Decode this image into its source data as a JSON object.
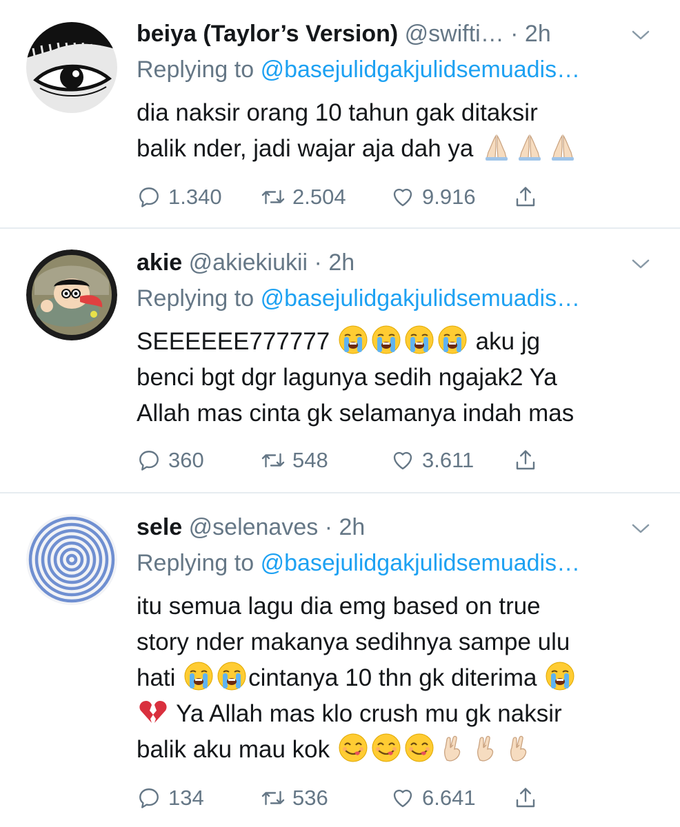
{
  "tweets": [
    {
      "name": "beiya (Taylor’s Version)",
      "handle_time": "@swifti… · 2h",
      "reply_prefix": "Replying to",
      "reply_mention": "@basejulidgakjulidsemuadis…",
      "avatar": "eye-drawing-avatar",
      "lines": [
        [
          {
            "t": "dia naksir orang 10 tahun gak ditaksir"
          }
        ],
        [
          {
            "t": "balik nder, jadi wajar aja dah ya "
          },
          {
            "e": "folded-hands"
          },
          {
            "e": "folded-hands"
          },
          {
            "e": "folded-hands"
          }
        ]
      ],
      "replies": "1.340",
      "retweets": "2.504",
      "likes": "9.916"
    },
    {
      "name": "akie",
      "handle_time": "@akiekiukii · 2h",
      "reply_prefix": "Replying to",
      "reply_mention": "@basejulidgakjulidsemuadis…",
      "avatar": "cartoon-character-avatar",
      "lines": [
        [
          {
            "t": "SEEEEEE777777 "
          },
          {
            "e": "loudly-crying-face"
          },
          {
            "e": "loudly-crying-face"
          },
          {
            "e": "loudly-crying-face"
          },
          {
            "e": "loudly-crying-face"
          },
          {
            "t": " aku jg"
          }
        ],
        [
          {
            "t": "benci bgt dgr lagunya sedih ngajak2 Ya"
          }
        ],
        [
          {
            "t": "Allah mas cinta gk selamanya indah mas"
          }
        ]
      ],
      "replies": "360",
      "retweets": "548",
      "likes": "3.611"
    },
    {
      "name": "sele",
      "handle_time": "@selenaves · 2h",
      "reply_prefix": "Replying to",
      "reply_mention": "@basejulidgakjulidsemuadis…",
      "avatar": "blue-spiral-avatar",
      "lines": [
        [
          {
            "t": "itu semua lagu dia emg based on true"
          }
        ],
        [
          {
            "t": "story nder makanya sedihnya sampe ulu"
          }
        ],
        [
          {
            "t": "hati "
          },
          {
            "e": "loudly-crying-face"
          },
          {
            "e": "loudly-crying-face"
          },
          {
            "t": "cintanya 10 thn gk diterima "
          },
          {
            "e": "loudly-crying-face"
          }
        ],
        [
          {
            "e": "broken-heart"
          },
          {
            "t": " Ya Allah mas klo crush mu gk naksir"
          }
        ],
        [
          {
            "t": "balik aku mau kok "
          },
          {
            "e": "face-savoring-food"
          },
          {
            "e": "face-savoring-food"
          },
          {
            "e": "face-savoring-food"
          },
          {
            "e": "crossed-fingers"
          },
          {
            "e": "crossed-fingers"
          },
          {
            "e": "crossed-fingers"
          }
        ]
      ],
      "replies": "134",
      "retweets": "536",
      "likes": "6.641"
    }
  ],
  "icons": {
    "reply": "reply-icon",
    "retweet": "retweet-icon",
    "like": "heart-icon",
    "share": "share-icon",
    "menu": "chevron-down-icon"
  },
  "colors": {
    "link": "#1da1f2",
    "secondary_text": "#657786",
    "primary_text": "#14171a",
    "divider": "#e6ecf0"
  }
}
